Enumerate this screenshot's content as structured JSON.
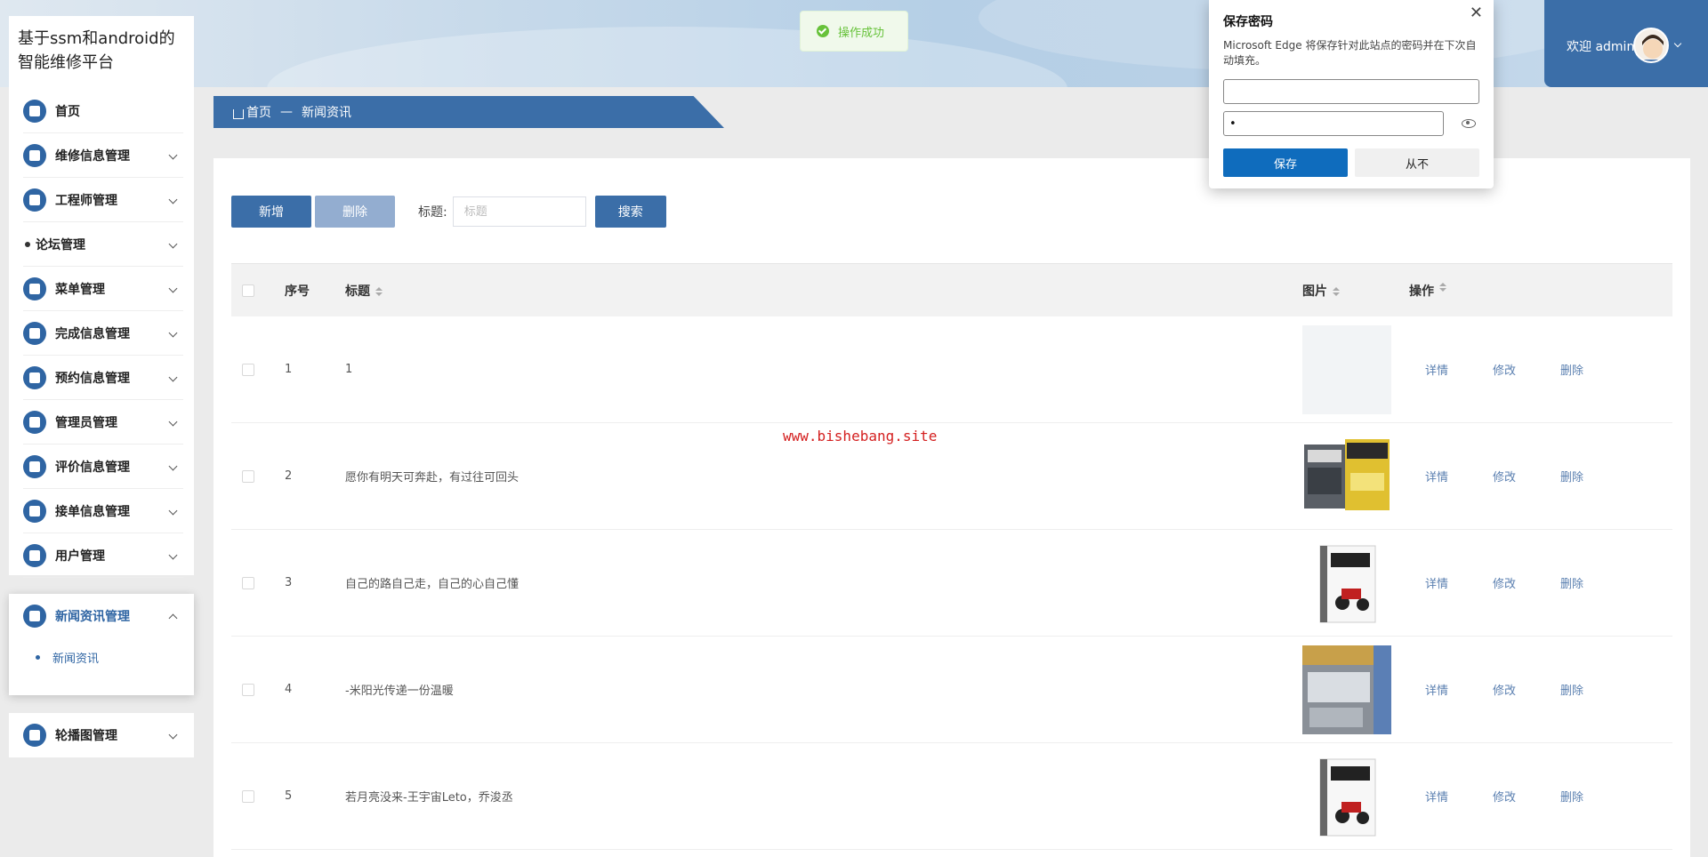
{
  "app": {
    "title": "基于ssm和android的智能维修平台"
  },
  "sidebar": {
    "items": [
      {
        "label": "首页",
        "icon": "home-icon"
      },
      {
        "label": "维修信息管理",
        "icon": "wrench-icon"
      },
      {
        "label": "工程师管理",
        "icon": "engineer-icon"
      },
      {
        "label": "论坛管理",
        "icon": "dot-icon"
      },
      {
        "label": "菜单管理",
        "icon": "menu-icon"
      },
      {
        "label": "完成信息管理",
        "icon": "check-icon"
      },
      {
        "label": "预约信息管理",
        "icon": "calendar-icon"
      },
      {
        "label": "管理员管理",
        "icon": "user-icon"
      },
      {
        "label": "评价信息管理",
        "icon": "comment-icon"
      },
      {
        "label": "接单信息管理",
        "icon": "order-icon"
      },
      {
        "label": "用户管理",
        "icon": "user-icon"
      }
    ],
    "open_group": {
      "label": "新闻资讯管理",
      "sub_item": "新闻资讯"
    },
    "last_item": {
      "label": "轮播图管理"
    }
  },
  "breadcrumb": {
    "home": "首页",
    "separator": "—",
    "current": "新闻资讯"
  },
  "toolbar": {
    "add_label": "新增",
    "delete_label": "删除",
    "search_label": "标题:",
    "search_placeholder": "标题",
    "search_button": "搜索"
  },
  "table": {
    "headers": {
      "no": "序号",
      "title": "标题",
      "image": "图片",
      "ops": "操作"
    },
    "ops": {
      "detail": "详情",
      "edit": "修改",
      "delete": "删除"
    },
    "rows": [
      {
        "no": "1",
        "title": "1"
      },
      {
        "no": "2",
        "title": "愿你有明天可奔赴，有过往可回头"
      },
      {
        "no": "3",
        "title": "自己的路自己走，自己的心自己懂"
      },
      {
        "no": "4",
        "title": "-米阳光传递一份温暖"
      },
      {
        "no": "5",
        "title": "若月亮没来-王宇宙Leto，乔浚丞"
      }
    ]
  },
  "toast": {
    "message": "操作成功"
  },
  "watermark": "www.bishebang.site",
  "user": {
    "greeting": "欢迎 admin"
  },
  "password_dialog": {
    "title": "保存密码",
    "description": "Microsoft Edge 将保存针对此站点的密码并在下次自动填充。",
    "username_value": "",
    "password_value": "•",
    "save_label": "保存",
    "never_label": "从不"
  },
  "colors": {
    "primary": "#3b6ea8",
    "edge_blue": "#0f6cbd",
    "success": "#67c23a",
    "watermark": "#d42020"
  }
}
